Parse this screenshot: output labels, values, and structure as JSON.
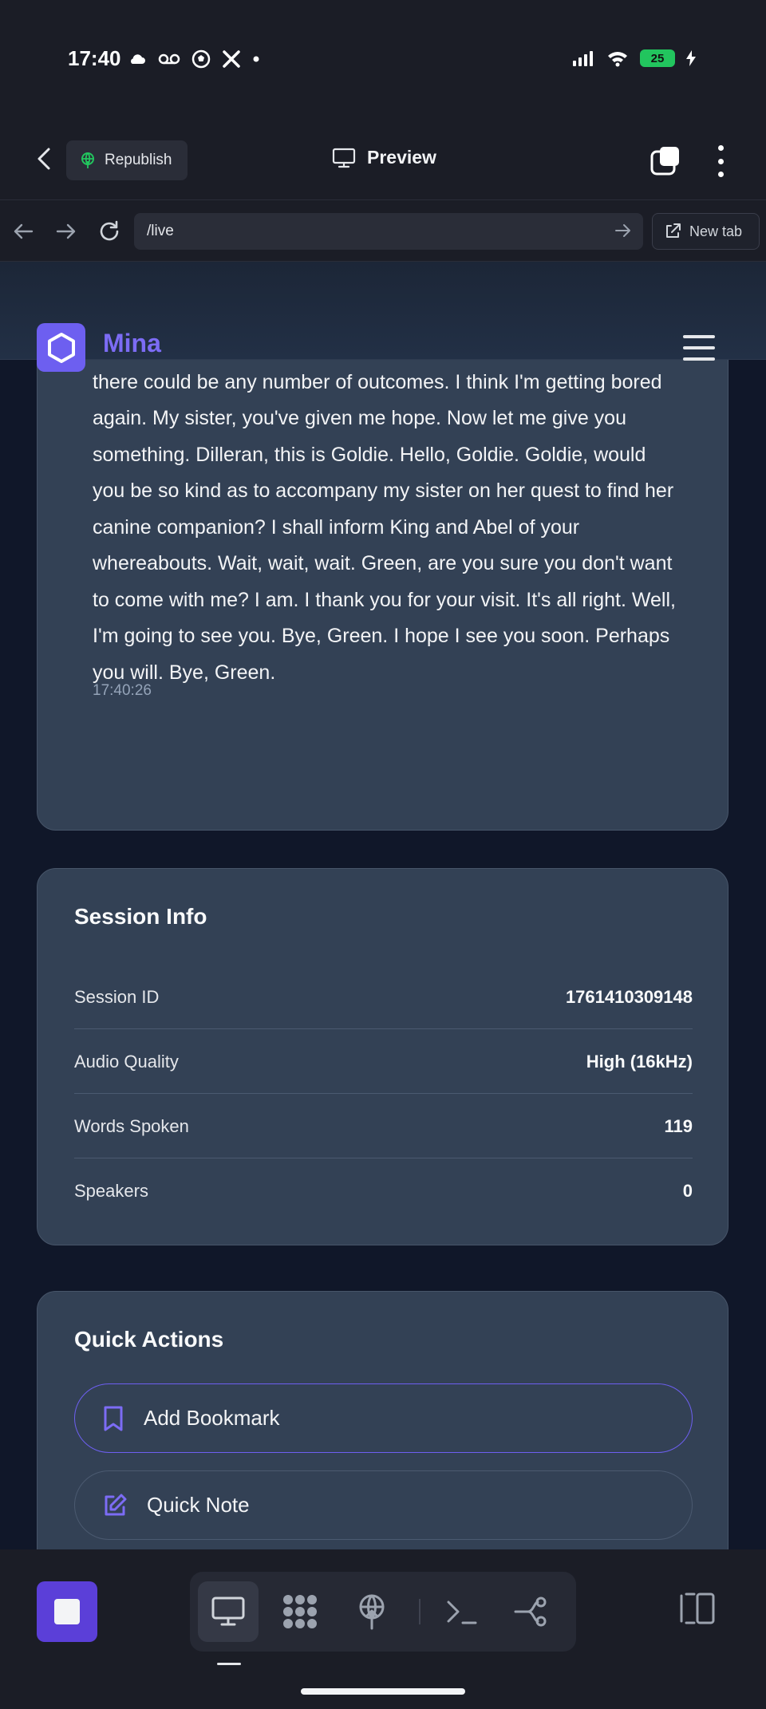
{
  "status_bar": {
    "time": "17:40",
    "battery": "25",
    "icons_left": [
      "cloud-icon",
      "voicemail-icon",
      "soccer-icon",
      "x-icon",
      "dot-icon"
    ],
    "icons_right": [
      "signal-icon",
      "wifi-icon",
      "battery-icon"
    ]
  },
  "header": {
    "republish_label": "Republish",
    "preview_label": "Preview"
  },
  "url_bar": {
    "url": "/live",
    "new_tab_label": "New tab"
  },
  "site": {
    "name": "Mina"
  },
  "transcript": {
    "text": "I suppose I am. You see, if there are any number of destinies, there could be any number of outcomes. I think I'm getting bored again. My sister, you've given me hope. Now let me give you something. Dilleran, this is Goldie. Hello, Goldie. Goldie, would you be so kind as to accompany my sister on her quest to find her canine companion? I shall inform King and Abel of your whereabouts. Wait, wait, wait. Green, are you sure you don't want to come with me? I am. I thank you for your visit. It's all right. Well, I'm going to see you. Bye, Green. I hope I see you soon. Perhaps you will. Bye, Green.",
    "timestamp": "17:40:26"
  },
  "session_info": {
    "title": "Session Info",
    "rows": [
      {
        "label": "Session ID",
        "value": "1761410309148"
      },
      {
        "label": "Audio Quality",
        "value": "High (16kHz)"
      },
      {
        "label": "Words Spoken",
        "value": "119"
      },
      {
        "label": "Speakers",
        "value": "0"
      }
    ]
  },
  "quick_actions": {
    "title": "Quick Actions",
    "items": [
      {
        "label": "Add Bookmark",
        "icon": "bookmark-icon"
      },
      {
        "label": "Quick Note",
        "icon": "edit-note-icon"
      }
    ]
  },
  "colors": {
    "accent": "#6d5ff0",
    "card": "#334155",
    "background": "#101729",
    "chrome": "#1b1d26"
  }
}
